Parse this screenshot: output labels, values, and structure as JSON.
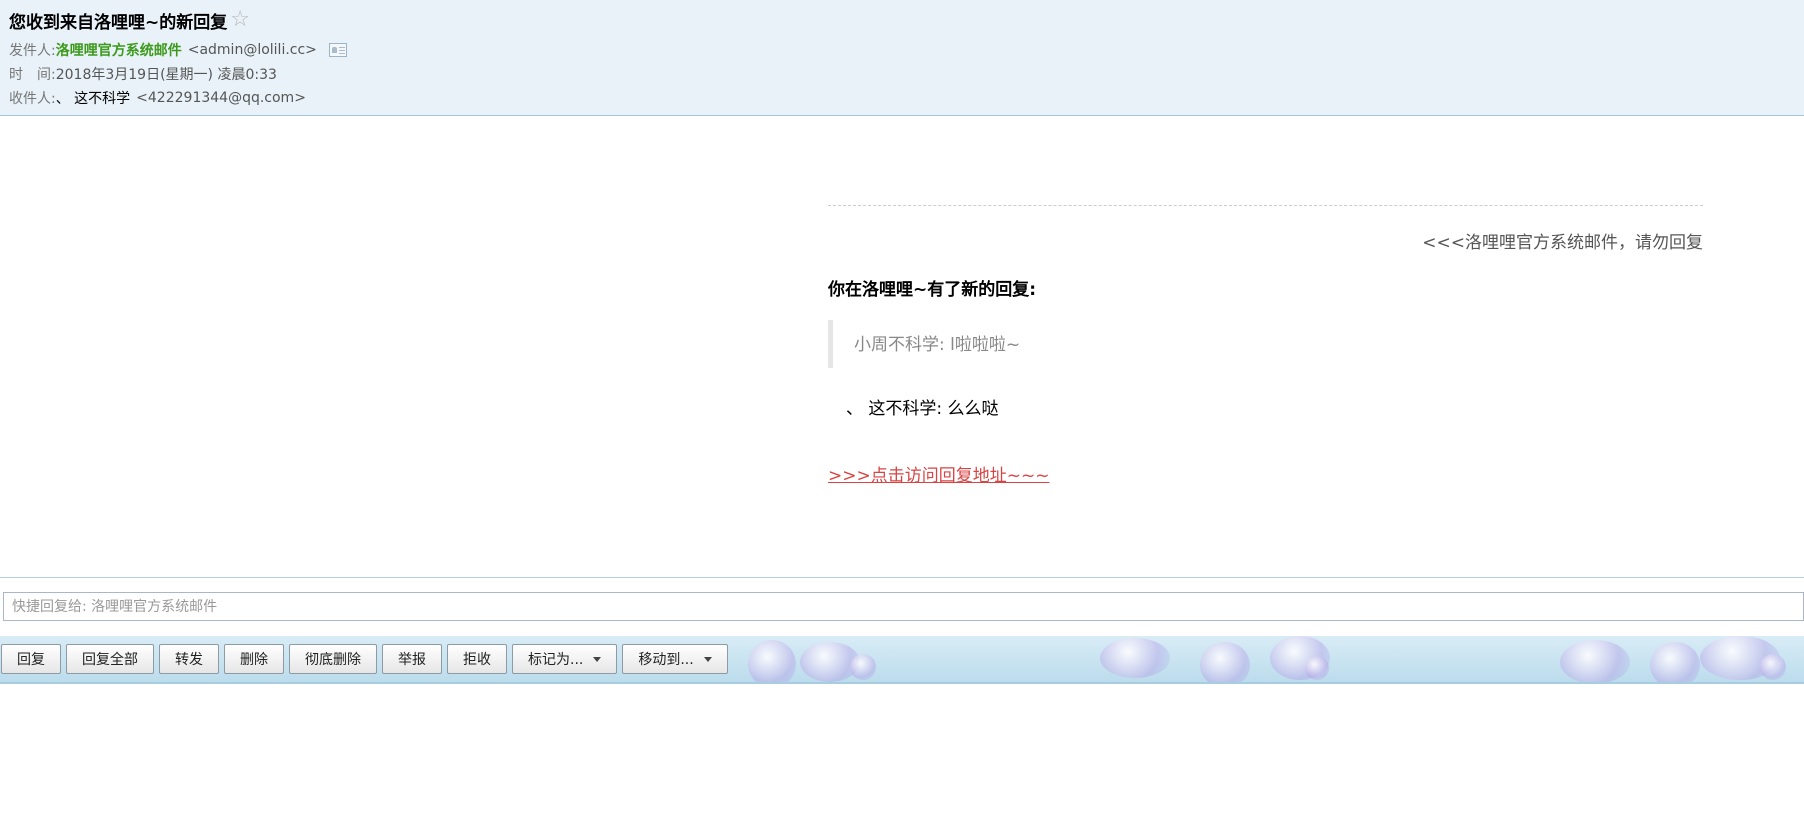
{
  "header": {
    "subject": "您收到来自洛哩哩~的新回复",
    "from_label": "发件人:",
    "sender_name": "洛哩哩官方系统邮件",
    "sender_email": "<admin@lolili.cc>",
    "time_label": "时　间:",
    "time_value": "2018年3月19日(星期一) 凌晨0:33",
    "to_label": "收件人:",
    "to_name": "、 这不科学",
    "to_email": "<422291344@qq.com>"
  },
  "body": {
    "no_reply_note": "<<<洛哩哩官方系统邮件，请勿回复",
    "heading": "你在洛哩哩~有了新的回复:",
    "quote": "小周不科学:  l啦啦啦~",
    "reply": "、 这不科学: 么么哒",
    "link_text": ">>>点击访问回复地址~~~"
  },
  "quick_reply": {
    "placeholder": "快捷回复给: 洛哩哩官方系统邮件"
  },
  "toolbar": {
    "reply": "回复",
    "reply_all": "回复全部",
    "forward": "转发",
    "delete": "删除",
    "delete_permanently": "彻底删除",
    "report": "举报",
    "reject": "拒收",
    "mark_as": "标记为...",
    "move_to": "移动到..."
  },
  "colors": {
    "header_bg": "#e9f2f9",
    "sender_green": "#3d9a1b",
    "link_red": "#d94343"
  }
}
